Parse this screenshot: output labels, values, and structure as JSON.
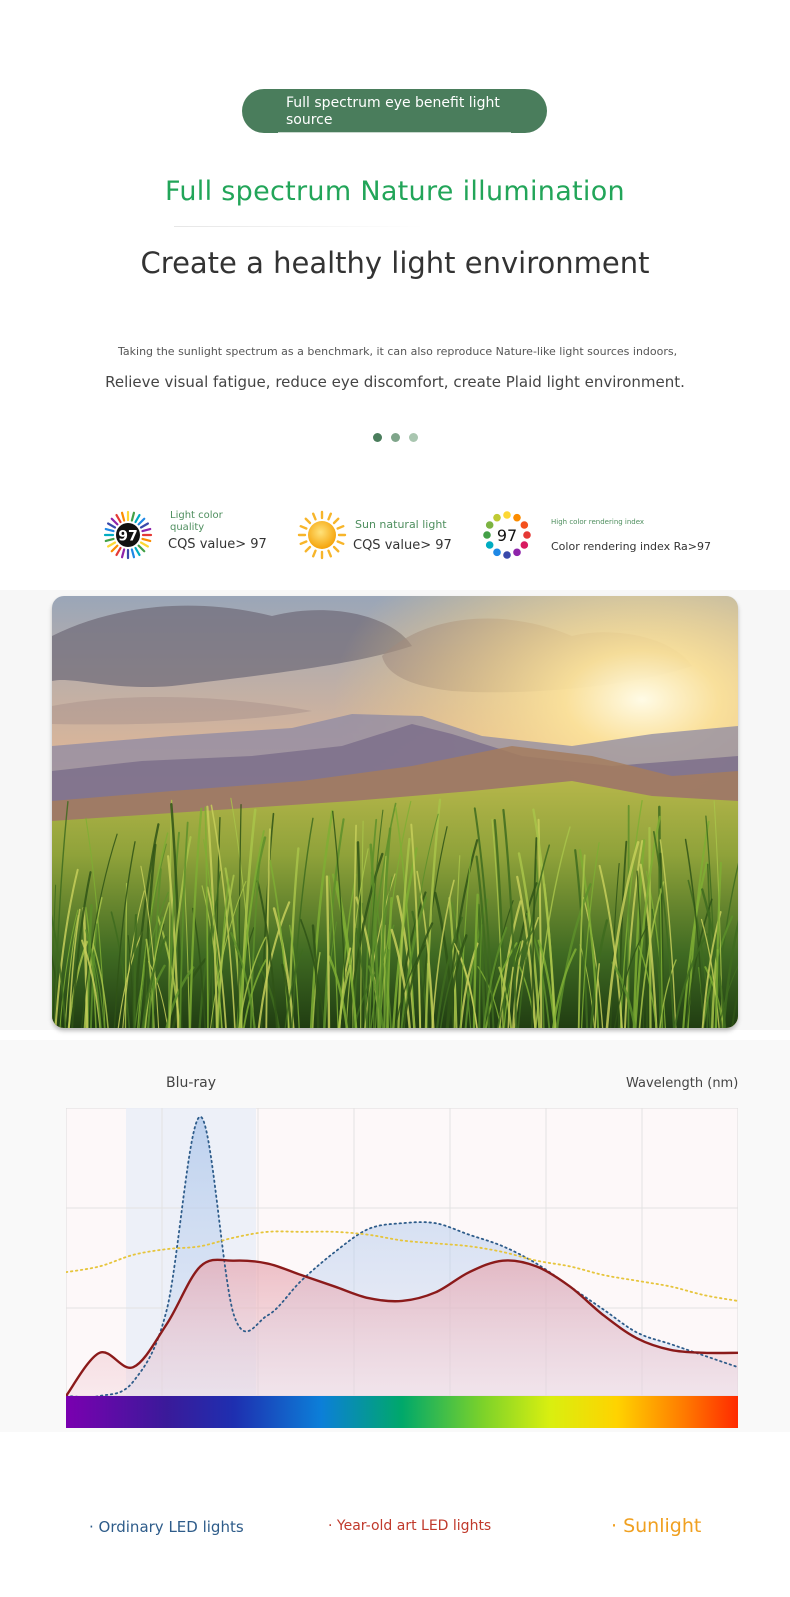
{
  "header": {
    "badge": "Full spectrum eye benefit light source",
    "subtitle": "Full spectrum Nature illumination",
    "title": "Create a healthy light environment",
    "desc_small": "Taking the sunlight spectrum as a benchmark, it can also reproduce Nature-like light sources indoors,",
    "desc_main": "Relieve visual fatigue, reduce eye discomfort, create Plaid light environment."
  },
  "colors": {
    "brand_green": "#4a7d5c",
    "title_green": "#22a559",
    "ordinary_led": "#2e5c8a",
    "art_led": "#c0392b",
    "sunlight": "#f0a020"
  },
  "features": [
    {
      "icon": "cqs-badge-icon",
      "badge": "97",
      "label": "Light color quality",
      "value": "CQS value> 97"
    },
    {
      "icon": "sun-icon",
      "label": "Sun natural light",
      "value": "CQS value> 97"
    },
    {
      "icon": "color-wheel-icon",
      "badge": "97",
      "label": "High color rendering index",
      "value": "Color rendering index Ra>97"
    }
  ],
  "photo": {
    "icon": "sunset-landscape-photo"
  },
  "chart_data": {
    "type": "line",
    "blu_ray_label": "Blu-ray",
    "xlabel": "Wavelength (nm)",
    "ylabel": "",
    "x": [
      0,
      0.05,
      0.1,
      0.15,
      0.2,
      0.25,
      0.3,
      0.35,
      0.4,
      0.45,
      0.5,
      0.55,
      0.6,
      0.65,
      0.7,
      0.75,
      0.8,
      0.85,
      0.9,
      0.95,
      1.0
    ],
    "ylim": [
      0,
      1
    ],
    "series": [
      {
        "name": "· Ordinary LED lights",
        "color": "#2e5c8a",
        "style": "dotted",
        "values": [
          0,
          0,
          0.05,
          0.3,
          0.97,
          0.28,
          0.28,
          0.4,
          0.5,
          0.58,
          0.6,
          0.6,
          0.56,
          0.52,
          0.46,
          0.38,
          0.3,
          0.22,
          0.18,
          0.14,
          0.1
        ]
      },
      {
        "name": "· Year-old art LED lights",
        "color": "#8b1a1a",
        "style": "solid",
        "values": [
          0,
          0.15,
          0.1,
          0.25,
          0.45,
          0.47,
          0.46,
          0.42,
          0.38,
          0.34,
          0.33,
          0.36,
          0.43,
          0.47,
          0.45,
          0.38,
          0.28,
          0.2,
          0.16,
          0.15,
          0.15
        ]
      },
      {
        "name": "· Sunlight",
        "color": "#e6c53c",
        "style": "dotted",
        "values": [
          0.43,
          0.45,
          0.49,
          0.51,
          0.52,
          0.55,
          0.57,
          0.57,
          0.57,
          0.56,
          0.54,
          0.53,
          0.52,
          0.5,
          0.47,
          0.45,
          0.42,
          0.4,
          0.38,
          0.35,
          0.33
        ]
      }
    ]
  }
}
